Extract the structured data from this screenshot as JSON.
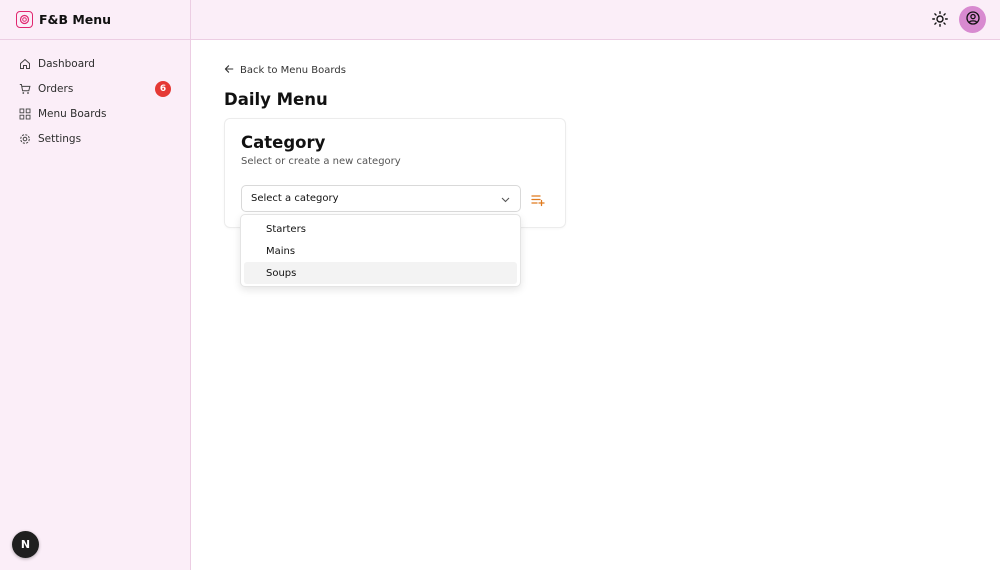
{
  "app": {
    "title": "F&B Menu"
  },
  "sidebar": {
    "items": [
      {
        "label": "Dashboard",
        "icon": "home-icon"
      },
      {
        "label": "Orders",
        "icon": "cart-icon",
        "badge": "6"
      },
      {
        "label": "Menu Boards",
        "icon": "grid-icon"
      },
      {
        "label": "Settings",
        "icon": "gear-icon"
      }
    ]
  },
  "corner_button": {
    "label": "N"
  },
  "header": {
    "theme_icon": "sun-icon",
    "avatar_icon": "user-circle-icon"
  },
  "main": {
    "back_link": "Back to Menu Boards",
    "page_title": "Daily Menu",
    "card": {
      "title": "Category",
      "subtitle": "Select or create a new category",
      "select_value": "Select a category",
      "options": [
        "Starters",
        "Mains",
        "Soups"
      ],
      "highlighted_option": "Soups"
    }
  },
  "colors": {
    "sidebar_bg": "#fbeef8",
    "badge": "#e53935",
    "accent": "#e07b1f",
    "avatar": "#d88ad0",
    "logo": "#e0266f"
  }
}
